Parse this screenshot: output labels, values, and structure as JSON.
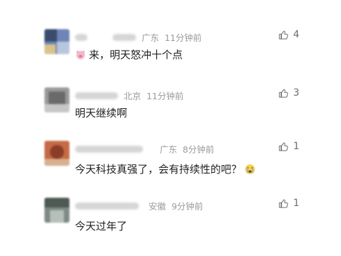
{
  "comments": [
    {
      "location": "广东",
      "time": "11分钟前",
      "likes": "4",
      "text": "来，明天怒冲十个点",
      "emoji_leading": "pig-emoji-icon",
      "avatar_colors": [
        "#3a4b6e",
        "#6e86b7",
        "#b8c6dd"
      ]
    },
    {
      "location": "北京",
      "time": "11分钟前",
      "likes": "3",
      "text": "明天继续啊",
      "avatar_colors": [
        "#6a6a6a",
        "#9a9a9a",
        "#c7c7c7"
      ]
    },
    {
      "location": "广东",
      "time": "8分钟前",
      "likes": "1",
      "text": "今天科技真强了，会有持续性的吧？",
      "emoji_trailing": "crying-face-emoji-icon",
      "avatar_colors": [
        "#8b3d2a",
        "#c56a45",
        "#d8b08f"
      ]
    },
    {
      "location": "安徽",
      "time": "9分钟前",
      "likes": "1",
      "text": "今天过年了",
      "avatar_colors": [
        "#4d5a53",
        "#7f8a84",
        "#b7bfba"
      ]
    }
  ]
}
